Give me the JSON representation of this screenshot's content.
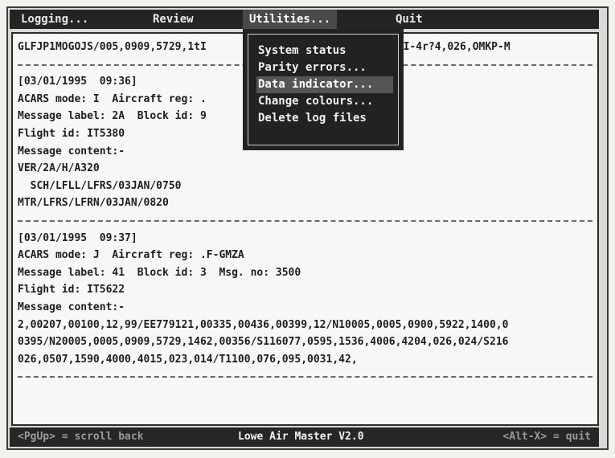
{
  "menu": {
    "logging": "Logging...",
    "review": "Review",
    "utilities": "Utilities...",
    "quit": "Quit"
  },
  "dropdown": {
    "items": [
      "System status",
      "Parity errors...",
      "Data indicator...",
      "Change colours...",
      "Delete log files"
    ],
    "highlighted": "Data indicator..."
  },
  "log": {
    "header_fragment_left": "GLFJP1MOGOJS/005,0909,5729,1tI",
    "header_fragment_right": "5KISKOGI-4r?4,026,OMKP-M",
    "entry1": {
      "timestamp": "[03/01/1995  09:36]",
      "mode_line": "ACARS mode: I  Aircraft reg: .",
      "label_line": "Message label: 2A  Block id: 9",
      "flight_line": "Flight id: IT5380",
      "content_heading": "Message content:-",
      "content": [
        "VER/2A/H/A320",
        "  SCH/LFLL/LFRS/03JAN/0750",
        "MTR/LFRS/LFRN/03JAN/0820"
      ]
    },
    "entry2": {
      "timestamp": "[03/01/1995  09:37]",
      "mode_line": "ACARS mode: J  Aircraft reg: .F-GMZA",
      "label_line": "Message label: 41  Block id: 3  Msg. no: 3500",
      "flight_line": "Flight id: IT5622",
      "content_heading": "Message content:-",
      "content": [
        "2,00207,00100,12,99/EE779121,00335,00436,00399,12/N10005,0005,0900,5922,1400,0",
        "0395/N20005,0005,0909,5729,1462,00356/S116077,0595,1536,4006,4204,026,024/S216",
        "026,0507,1590,4000,4015,023,014/T1100,076,095,0031,42,"
      ]
    }
  },
  "status": {
    "left": "<PgUp> = scroll back",
    "center": "Lowe Air Master V2.0",
    "right": "<Alt-X> = quit"
  }
}
